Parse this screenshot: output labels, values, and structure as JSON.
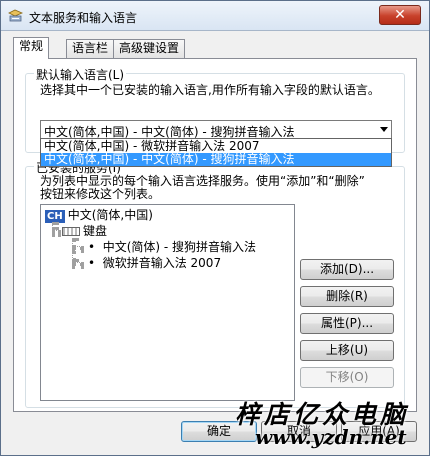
{
  "window": {
    "title": "文本服务和输入语言",
    "close_glyph": "✕"
  },
  "tabs": [
    {
      "label": "常规",
      "active": true
    },
    {
      "label": "语言栏",
      "active": false
    },
    {
      "label": "高级键设置",
      "active": false
    }
  ],
  "default_language": {
    "group_title": "默认输入语言(L)",
    "description": "选择其中一个已安装的输入语言,用作所有输入字段的默认语言。",
    "selected_value": "中文(简体,中国) - 中文(简体) - 搜狗拼音输入法",
    "dropdown_options": [
      {
        "label": "中文(简体,中国) - 微软拼音输入法 2007",
        "selected": false
      },
      {
        "label": "中文(简体,中国) - 中文(简体) - 搜狗拼音输入法",
        "selected": true
      }
    ]
  },
  "installed_services": {
    "group_title": "已安装的服务(I)",
    "description_line1": "为列表中显示的每个输入语言选择服务。使用“添加”和“删除”",
    "description_line2": "按钮来修改这个列表。",
    "tree": {
      "language_badge": "CH",
      "language": "中文(简体,中国)",
      "category": "键盘",
      "items": [
        "中文(简体) - 搜狗拼音输入法",
        "微软拼音输入法 2007"
      ]
    },
    "buttons": {
      "add": "添加(D)...",
      "remove": "删除(R)",
      "properties": "属性(P)...",
      "move_up": "上移(U)",
      "move_down": "下移(O)"
    }
  },
  "footer": {
    "ok": "确定",
    "cancel": "取消",
    "apply": "应用(A)"
  },
  "watermark": {
    "line1": "梓店亿众电脑",
    "line2": "www.yzdn.net"
  },
  "colors": {
    "selection": "#3399ff",
    "close_button": "#c8412b",
    "language_badge": "#2b5fb8"
  }
}
